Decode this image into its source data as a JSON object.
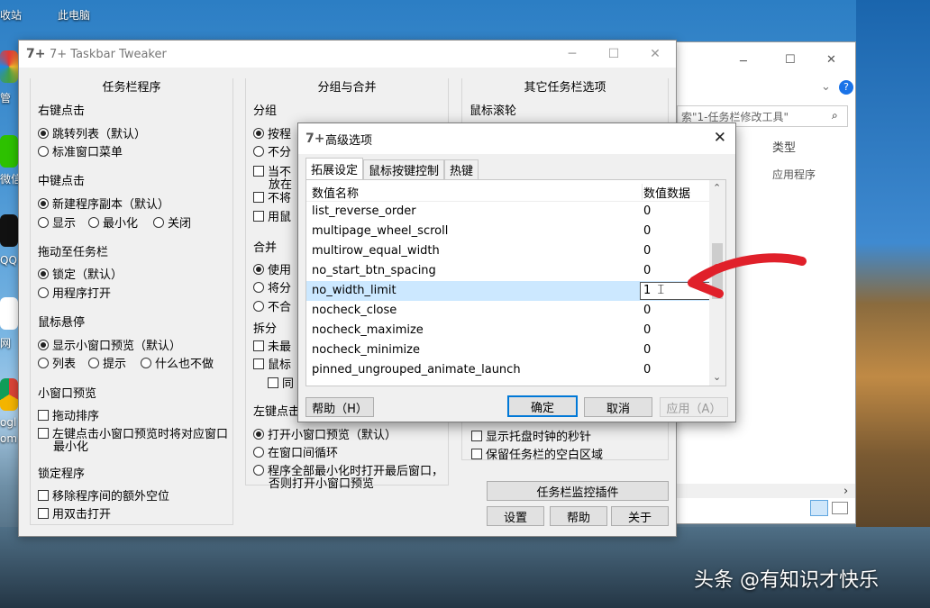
{
  "desktop": {
    "icons": [
      {
        "label": "收站"
      },
      {
        "label": "此电脑"
      }
    ],
    "side_labels": [
      "管",
      "微信",
      "QQ",
      "网",
      "ogl",
      "om"
    ]
  },
  "explorer": {
    "search_placeholder": "索\"1-任务栏修改工具\"",
    "col_header": "类型",
    "row_value": "应用程序"
  },
  "main": {
    "title": "7+ Taskbar Tweaker",
    "col1": {
      "title": "任务栏程序",
      "right_click": {
        "label": "右键点击",
        "options": [
          "跳转列表（默认）",
          "标准窗口菜单"
        ],
        "selected": 0
      },
      "middle_click": {
        "label": "中键点击",
        "options": [
          "新建程序副本（默认）",
          "显示",
          "最小化",
          "关闭"
        ],
        "selected": 0
      },
      "drag": {
        "label": "拖动至任务栏",
        "options": [
          "锁定（默认）",
          "用程序打开"
        ],
        "selected": 0
      },
      "hover": {
        "label": "鼠标悬停",
        "options": [
          "显示小窗口预览（默认）",
          "列表",
          "提示",
          "什么也不做"
        ],
        "selected": 0
      },
      "thumb": {
        "label": "小窗口预览",
        "checks": [
          "拖动排序",
          "左键点击小窗口预览时将对应窗口",
          "最小化"
        ]
      },
      "pinned": {
        "label": "锁定程序",
        "checks": [
          "移除程序间的额外空位",
          "用双击打开"
        ]
      }
    },
    "col2": {
      "title": "分组与合并",
      "group": {
        "label": "分组",
        "items": [
          "按程",
          "不分",
          "当不",
          "放在",
          "不将",
          "用鼠"
        ]
      },
      "combine": {
        "label": "合并",
        "items": [
          "使用",
          "将分",
          "不合"
        ]
      },
      "split": {
        "label": "拆分",
        "items": [
          "未最",
          "鼠标",
          "同"
        ]
      },
      "leftclick": {
        "label": "左键点击",
        "options": [
          "打开小窗口预览（默认）",
          "在窗口间循环",
          "程序全部最小化时打开最后窗口，",
          "否则打开小窗口预览"
        ],
        "selected": 0
      }
    },
    "col3": {
      "title": "其它任务栏选项",
      "wheel": {
        "label": "鼠标滚轮"
      },
      "checks": [
        "显示托盘时钟的秒针",
        "保留任务栏的空白区域"
      ]
    },
    "buttons": {
      "monitor": "任务栏监控插件",
      "settings": "设置",
      "help": "帮助",
      "about": "关于"
    }
  },
  "dialog": {
    "title": "高级选项",
    "tabs": [
      "拓展设定",
      "鼠标按键控制",
      "热键"
    ],
    "columns": [
      "数值名称",
      "数值数据"
    ],
    "rows": [
      {
        "name": "list_reverse_order",
        "value": "0"
      },
      {
        "name": "multipage_wheel_scroll",
        "value": "0"
      },
      {
        "name": "multirow_equal_width",
        "value": "0"
      },
      {
        "name": "no_start_btn_spacing",
        "value": "0"
      },
      {
        "name": "no_width_limit",
        "value": "1"
      },
      {
        "name": "nocheck_close",
        "value": "0"
      },
      {
        "name": "nocheck_maximize",
        "value": "0"
      },
      {
        "name": "nocheck_minimize",
        "value": "0"
      },
      {
        "name": "pinned_ungrouped_animate_launch",
        "value": "0"
      }
    ],
    "selected_row": 4,
    "buttons": {
      "help": "帮助（H）",
      "ok": "确定",
      "cancel": "取消",
      "apply": "应用（A）"
    }
  },
  "watermark": "头条 @有知识才快乐",
  "colors": {
    "selection": "#cce8ff",
    "arrow": "#e0202a",
    "ok_border": "#0078d7"
  }
}
